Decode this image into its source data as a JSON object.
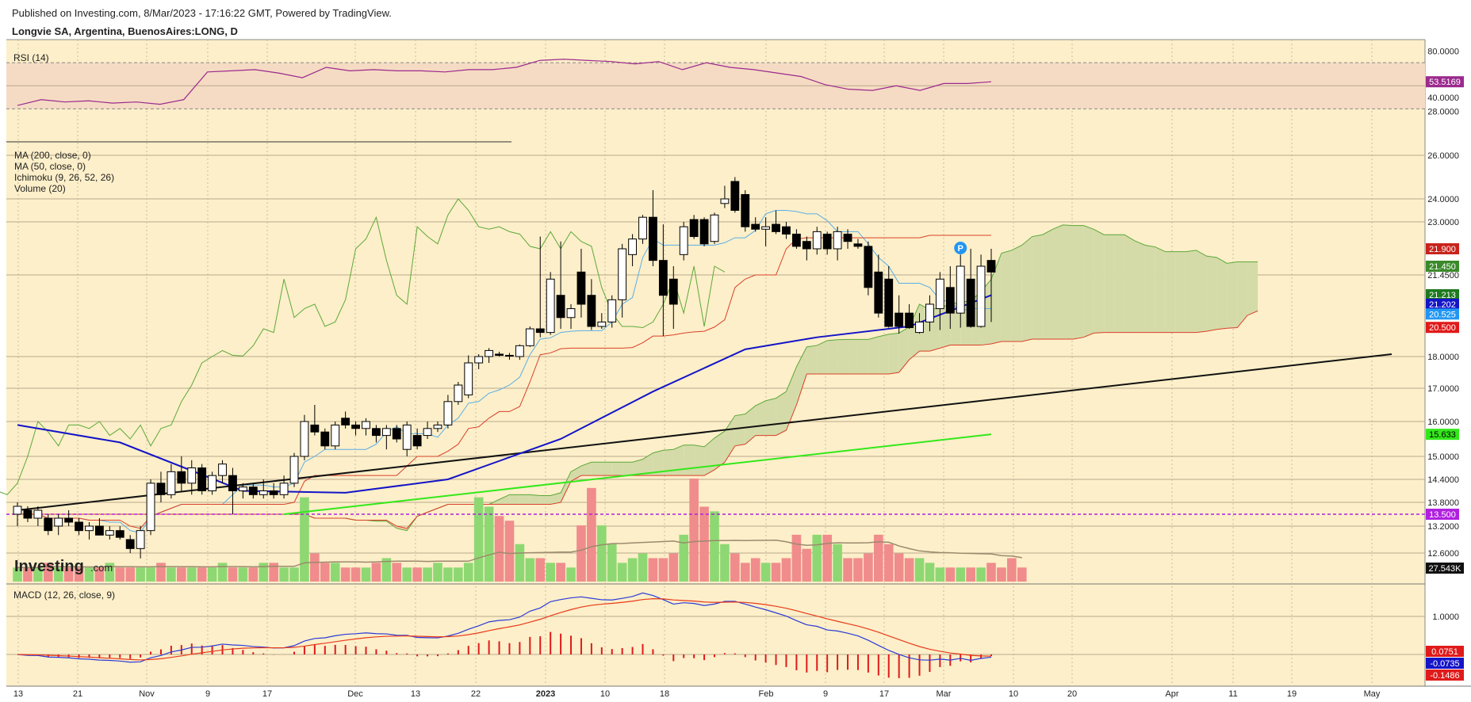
{
  "header": {
    "published": "Published on Investing.com, 8/Mar/2023 - 17:16:22 GMT, Powered by TradingView.",
    "symbol": "Longvie SA, Argentina, BuenosAires:LONG, D"
  },
  "branding": {
    "logo": "Investing",
    "logo_suffix": ".com"
  },
  "colors": {
    "background": "#fdefc9",
    "rsi_band": "#f5dbc3",
    "rsi_line": "#9b2a8e",
    "ma200": "#33e81a",
    "ma50": "#1414c8",
    "tenkan": "#5aaee8",
    "kijun": "#d9402a",
    "span_a": "#5da83a",
    "span_b": "#d9402a",
    "kumo_bull": "#d4dba8",
    "kumo_bear": "#f8c8a8",
    "trendline": "#111111",
    "support_line": "#b020e0",
    "vol_up": "#8ed873",
    "vol_down": "#f08c8c",
    "macd_line": "#2b3ad8",
    "signal_line": "#e83a1a",
    "hist": "#e01a1a"
  },
  "chart_data": [
    {
      "type": "line",
      "panel": "rsi",
      "label": "RSI (14)",
      "ylim": [
        20,
        90
      ],
      "levels": [
        28,
        40,
        80
      ],
      "band": [
        30,
        70
      ],
      "last_value": "53.5169",
      "x": [
        "Oct 13",
        "Oct 17",
        "Oct 21",
        "Oct 25",
        "Oct 28",
        "Nov 1",
        "Nov 4",
        "Nov 9",
        "Nov 11",
        "Nov 14",
        "Nov 17",
        "Nov 21",
        "Nov 24",
        "Nov 28",
        "Dec 1",
        "Dec 5",
        "Dec 9",
        "Dec 13",
        "Dec 16",
        "Dec 19",
        "Dec 22",
        "Dec 27",
        "Dec 30",
        "Jan 4",
        "Jan 7",
        "Jan 10",
        "Jan 14",
        "Jan 18",
        "Jan 20",
        "Jan 24",
        "Jan 28",
        "Feb 1",
        "Feb 4",
        "Feb 9",
        "Feb 13",
        "Feb 17",
        "Feb 21",
        "Feb 24",
        "Feb 28",
        "Mar 2",
        "Mar 6",
        "Mar 8"
      ],
      "values": [
        33,
        38,
        36,
        37,
        35,
        36,
        34,
        38,
        62,
        63,
        64,
        61,
        57,
        66,
        63,
        64,
        63,
        63,
        62,
        64,
        64,
        66,
        72,
        73,
        72,
        71,
        69,
        71,
        64,
        70,
        66,
        64,
        61,
        58,
        51,
        47,
        46,
        50,
        46,
        52,
        52,
        53.5
      ]
    },
    {
      "type": "candlestick",
      "panel": "price",
      "labels": [
        "MA (200, close, 0)",
        "MA (50, close, 0)",
        "Ichimoku (9, 26, 52, 26)",
        "Volume (20)"
      ],
      "ylim": [
        12.1,
        27.0
      ],
      "y_ticks": [
        12.6,
        13.2,
        13.8,
        14.4,
        15.0,
        16.0,
        17.0,
        18.0,
        21.45,
        23.0,
        24.0,
        26.0
      ],
      "price_tags": [
        {
          "value": "21.900",
          "bg": "#c8241c",
          "fg": "#ffffff",
          "y": 21.9
        },
        {
          "value": "21.450",
          "bg": "#3a8a2a",
          "fg": "#ffffff",
          "y": 21.6
        },
        {
          "value": "21.213",
          "bg": "#1f7a1f",
          "fg": "#ffffff",
          "y": 21.213
        },
        {
          "value": "21.202",
          "bg": "#1414c8",
          "fg": "#ffffff",
          "y": 21.0
        },
        {
          "value": "20.525",
          "bg": "#2196f3",
          "fg": "#ffffff",
          "y": 20.78
        },
        {
          "value": "20.500",
          "bg": "#e01a1a",
          "fg": "#ffffff",
          "y": 20.42
        },
        {
          "value": "15.633",
          "bg": "#33e81a",
          "fg": "#000000",
          "y": 15.633
        },
        {
          "value": "13.500",
          "bg": "#b020e0",
          "fg": "#ffffff",
          "y": 13.5
        }
      ],
      "candles": [
        {
          "d": "Oct 13",
          "o": 13.5,
          "h": 13.8,
          "l": 13.2,
          "c": 13.7
        },
        {
          "d": "Oct 17",
          "o": 13.6,
          "h": 13.7,
          "l": 13.3,
          "c": 13.4
        },
        {
          "d": "Oct 19",
          "o": 13.4,
          "h": 13.7,
          "l": 13.2,
          "c": 13.6
        },
        {
          "d": "Oct 21",
          "o": 13.4,
          "h": 13.5,
          "l": 13.0,
          "c": 13.1
        },
        {
          "d": "Oct 24",
          "o": 13.2,
          "h": 13.5,
          "l": 13.0,
          "c": 13.4
        },
        {
          "d": "Oct 26",
          "o": 13.4,
          "h": 13.6,
          "l": 13.2,
          "c": 13.3
        },
        {
          "d": "Oct 28",
          "o": 13.3,
          "h": 13.4,
          "l": 13.0,
          "c": 13.1
        },
        {
          "d": "Oct 31",
          "o": 13.1,
          "h": 13.3,
          "l": 12.9,
          "c": 13.2
        },
        {
          "d": "Nov 2",
          "o": 13.2,
          "h": 13.4,
          "l": 13.0,
          "c": 13.0
        },
        {
          "d": "Nov 4",
          "o": 13.0,
          "h": 13.2,
          "l": 12.9,
          "c": 13.1
        },
        {
          "d": "Nov 7",
          "o": 13.1,
          "h": 13.2,
          "l": 12.9,
          "c": 12.95
        },
        {
          "d": "Nov 9",
          "o": 12.9,
          "h": 13.0,
          "l": 12.6,
          "c": 12.7
        },
        {
          "d": "Nov 10",
          "o": 12.7,
          "h": 13.2,
          "l": 12.5,
          "c": 13.1
        },
        {
          "d": "Nov 11",
          "o": 13.1,
          "h": 14.4,
          "l": 13.0,
          "c": 14.3
        },
        {
          "d": "Nov 14",
          "o": 14.3,
          "h": 14.6,
          "l": 13.8,
          "c": 14.0
        },
        {
          "d": "Nov 15",
          "o": 14.0,
          "h": 14.8,
          "l": 13.9,
          "c": 14.6
        },
        {
          "d": "Nov 16",
          "o": 14.6,
          "h": 15.0,
          "l": 14.1,
          "c": 14.3
        },
        {
          "d": "Nov 17",
          "o": 14.3,
          "h": 14.9,
          "l": 14.0,
          "c": 14.7
        },
        {
          "d": "Nov 18",
          "o": 14.7,
          "h": 14.8,
          "l": 14.0,
          "c": 14.1
        },
        {
          "d": "Nov 21",
          "o": 14.1,
          "h": 14.6,
          "l": 14.0,
          "c": 14.5
        },
        {
          "d": "Nov 22",
          "o": 14.5,
          "h": 14.9,
          "l": 14.3,
          "c": 14.8
        },
        {
          "d": "Nov 23",
          "o": 14.5,
          "h": 14.7,
          "l": 13.5,
          "c": 14.1
        },
        {
          "d": "Nov 24",
          "o": 14.1,
          "h": 14.3,
          "l": 13.9,
          "c": 14.2
        },
        {
          "d": "Nov 25",
          "o": 14.2,
          "h": 14.3,
          "l": 13.9,
          "c": 14.0
        },
        {
          "d": "Nov 28",
          "o": 14.0,
          "h": 14.4,
          "l": 13.9,
          "c": 14.1
        },
        {
          "d": "Nov 29",
          "o": 14.1,
          "h": 14.3,
          "l": 13.9,
          "c": 14.0
        },
        {
          "d": "Nov 30",
          "o": 14.0,
          "h": 14.5,
          "l": 13.9,
          "c": 14.3
        },
        {
          "d": "Dec 1",
          "o": 14.3,
          "h": 15.1,
          "l": 14.2,
          "c": 15.0
        },
        {
          "d": "Dec 2",
          "o": 15.0,
          "h": 16.2,
          "l": 14.9,
          "c": 16.0
        },
        {
          "d": "Dec 5",
          "o": 15.9,
          "h": 16.5,
          "l": 15.6,
          "c": 15.7
        },
        {
          "d": "Dec 6",
          "o": 15.7,
          "h": 15.8,
          "l": 15.2,
          "c": 15.3
        },
        {
          "d": "Dec 7",
          "o": 15.3,
          "h": 16.0,
          "l": 15.2,
          "c": 15.9
        },
        {
          "d": "Dec 9",
          "o": 16.1,
          "h": 16.3,
          "l": 15.8,
          "c": 15.9
        },
        {
          "d": "Dec 12",
          "o": 15.9,
          "h": 16.0,
          "l": 15.6,
          "c": 15.8
        },
        {
          "d": "Dec 13",
          "o": 15.8,
          "h": 16.1,
          "l": 15.6,
          "c": 16.0
        },
        {
          "d": "Dec 14",
          "o": 15.8,
          "h": 15.9,
          "l": 15.4,
          "c": 15.6
        },
        {
          "d": "Dec 15",
          "o": 15.6,
          "h": 15.9,
          "l": 15.2,
          "c": 15.8
        },
        {
          "d": "Dec 16",
          "o": 15.8,
          "h": 15.9,
          "l": 15.4,
          "c": 15.5
        },
        {
          "d": "Dec 19",
          "o": 15.2,
          "h": 16.0,
          "l": 15.0,
          "c": 15.9
        },
        {
          "d": "Dec 20",
          "o": 15.6,
          "h": 15.8,
          "l": 15.2,
          "c": 15.3
        },
        {
          "d": "Dec 21",
          "o": 15.6,
          "h": 16.0,
          "l": 15.5,
          "c": 15.8
        },
        {
          "d": "Dec 22",
          "o": 15.8,
          "h": 16.0,
          "l": 15.7,
          "c": 15.9
        },
        {
          "d": "Dec 23",
          "o": 15.9,
          "h": 16.8,
          "l": 15.8,
          "c": 16.6
        },
        {
          "d": "Dec 26",
          "o": 16.6,
          "h": 17.2,
          "l": 16.5,
          "c": 17.1
        },
        {
          "d": "Dec 27",
          "o": 16.8,
          "h": 18.1,
          "l": 16.7,
          "c": 17.8
        },
        {
          "d": "Dec 28",
          "o": 17.8,
          "h": 18.2,
          "l": 17.6,
          "c": 18.0
        },
        {
          "d": "Dec 29",
          "o": 18.0,
          "h": 18.7,
          "l": 17.8,
          "c": 18.5
        },
        {
          "d": "Dec 30",
          "o": 18.2,
          "h": 18.4,
          "l": 18.0,
          "c": 18.1
        },
        {
          "d": "Jan 2",
          "o": 18.1,
          "h": 18.3,
          "l": 17.9,
          "c": 18.05
        },
        {
          "d": "Jan 3",
          "o": 18.0,
          "h": 19.0,
          "l": 17.9,
          "c": 18.9
        },
        {
          "d": "Jan 4",
          "o": 18.9,
          "h": 20.5,
          "l": 18.8,
          "c": 20.3
        },
        {
          "d": "Jan 5",
          "o": 20.3,
          "h": 22.4,
          "l": 19.6,
          "c": 20.0
        },
        {
          "d": "Jan 6",
          "o": 20.0,
          "h": 21.5,
          "l": 19.8,
          "c": 21.4
        },
        {
          "d": "Jan 9",
          "o": 21.2,
          "h": 22.2,
          "l": 20.3,
          "c": 20.7
        },
        {
          "d": "Jan 10",
          "o": 20.7,
          "h": 21.0,
          "l": 20.3,
          "c": 20.9
        },
        {
          "d": "Jan 11",
          "o": 21.5,
          "h": 21.9,
          "l": 20.7,
          "c": 21.0
        },
        {
          "d": "Jan 12",
          "o": 21.2,
          "h": 21.4,
          "l": 20.2,
          "c": 20.5
        },
        {
          "d": "Jan 13",
          "o": 20.5,
          "h": 20.8,
          "l": 20.3,
          "c": 20.6
        },
        {
          "d": "Jan 16",
          "o": 20.6,
          "h": 21.2,
          "l": 20.4,
          "c": 21.1
        },
        {
          "d": "Jan 17",
          "o": 21.1,
          "h": 22.1,
          "l": 20.7,
          "c": 21.9
        },
        {
          "d": "Jan 18",
          "o": 21.8,
          "h": 22.5,
          "l": 21.6,
          "c": 22.3
        },
        {
          "d": "Jan 19",
          "o": 22.3,
          "h": 23.3,
          "l": 22.1,
          "c": 23.2
        },
        {
          "d": "Jan 20",
          "o": 23.2,
          "h": 24.4,
          "l": 21.6,
          "c": 21.7
        },
        {
          "d": "Jan 23",
          "o": 21.7,
          "h": 22.9,
          "l": 19.7,
          "c": 21.2
        },
        {
          "d": "Jan 24",
          "o": 21.4,
          "h": 21.6,
          "l": 20.3,
          "c": 21.0
        },
        {
          "d": "Jan 25",
          "o": 21.8,
          "h": 23.0,
          "l": 21.7,
          "c": 22.8
        },
        {
          "d": "Jan 26",
          "o": 23.1,
          "h": 23.3,
          "l": 22.3,
          "c": 22.4
        },
        {
          "d": "Jan 27",
          "o": 23.1,
          "h": 23.2,
          "l": 22.0,
          "c": 22.1
        },
        {
          "d": "Jan 30",
          "o": 22.2,
          "h": 23.4,
          "l": 22.1,
          "c": 23.3
        },
        {
          "d": "Jan 31",
          "o": 23.8,
          "h": 24.6,
          "l": 23.6,
          "c": 24.0
        },
        {
          "d": "Feb 1",
          "o": 24.8,
          "h": 25.0,
          "l": 23.4,
          "c": 23.5
        },
        {
          "d": "Feb 2",
          "o": 24.2,
          "h": 24.4,
          "l": 22.6,
          "c": 22.8
        },
        {
          "d": "Feb 3",
          "o": 22.9,
          "h": 23.2,
          "l": 22.6,
          "c": 22.7
        },
        {
          "d": "Feb 6",
          "o": 22.7,
          "h": 23.2,
          "l": 22.0,
          "c": 22.8
        },
        {
          "d": "Feb 7",
          "o": 22.9,
          "h": 23.5,
          "l": 22.5,
          "c": 22.6
        },
        {
          "d": "Feb 8",
          "o": 22.8,
          "h": 23.0,
          "l": 22.3,
          "c": 22.5
        },
        {
          "d": "Feb 9",
          "o": 22.5,
          "h": 22.7,
          "l": 21.9,
          "c": 22.0
        },
        {
          "d": "Feb 10",
          "o": 22.2,
          "h": 22.4,
          "l": 21.7,
          "c": 21.9
        },
        {
          "d": "Feb 13",
          "o": 21.9,
          "h": 22.8,
          "l": 21.8,
          "c": 22.6
        },
        {
          "d": "Feb 14",
          "o": 22.5,
          "h": 22.6,
          "l": 21.8,
          "c": 21.9
        },
        {
          "d": "Feb 15",
          "o": 21.9,
          "h": 22.8,
          "l": 21.7,
          "c": 22.6
        },
        {
          "d": "Feb 16",
          "o": 22.5,
          "h": 22.7,
          "l": 21.9,
          "c": 22.2
        },
        {
          "d": "Feb 17",
          "o": 22.1,
          "h": 22.3,
          "l": 21.9,
          "c": 22.0
        },
        {
          "d": "Feb 20",
          "o": 22.0,
          "h": 22.2,
          "l": 21.2,
          "c": 21.3
        },
        {
          "d": "Feb 21",
          "o": 21.5,
          "h": 21.8,
          "l": 20.7,
          "c": 20.8
        },
        {
          "d": "Feb 22",
          "o": 21.4,
          "h": 21.6,
          "l": 20.4,
          "c": 20.5
        },
        {
          "d": "Feb 23",
          "o": 20.8,
          "h": 21.2,
          "l": 19.9,
          "c": 20.5
        },
        {
          "d": "Feb 24",
          "o": 20.8,
          "h": 21.0,
          "l": 20.3,
          "c": 20.4
        },
        {
          "d": "Feb 27",
          "o": 20.0,
          "h": 20.8,
          "l": 19.9,
          "c": 20.6
        },
        {
          "d": "Feb 28",
          "o": 20.6,
          "h": 21.2,
          "l": 20.1,
          "c": 21.0
        },
        {
          "d": "Mar 1",
          "o": 20.9,
          "h": 21.5,
          "l": 20.2,
          "c": 21.4
        },
        {
          "d": "Mar 2",
          "o": 21.3,
          "h": 21.6,
          "l": 20.3,
          "c": 20.8
        },
        {
          "d": "Mar 3",
          "o": 20.8,
          "h": 21.8,
          "l": 20.4,
          "c": 21.6
        },
        {
          "d": "Mar 6",
          "o": 21.4,
          "h": 21.9,
          "l": 20.4,
          "c": 20.5
        },
        {
          "d": "Mar 7",
          "o": 20.5,
          "h": 21.8,
          "l": 20.4,
          "c": 21.6
        },
        {
          "d": "Mar 8",
          "o": 21.7,
          "h": 21.9,
          "l": 20.6,
          "c": 21.5
        }
      ],
      "ma200": {
        "x": [
          "Nov 30",
          "Mar 8"
        ],
        "values": [
          13.5,
          15.633
        ]
      },
      "ma50": {
        "x": [
          "Oct 13",
          "Nov 7",
          "Nov 24",
          "Dec 9",
          "Dec 23",
          "Jan 9",
          "Jan 20",
          "Feb 2",
          "Feb 13",
          "Feb 24",
          "Mar 8"
        ],
        "values": [
          15.9,
          15.4,
          14.1,
          14.05,
          14.4,
          15.5,
          16.9,
          18.6,
          19.6,
          20.5,
          21.202
        ]
      },
      "trendline": {
        "x": [
          "Oct 13",
          "May 20"
        ],
        "values": [
          13.6,
          18.2
        ]
      },
      "support_line": {
        "value": 13.5
      },
      "events": [
        {
          "date": "Mar 3",
          "label": "P",
          "color": "#2196f3"
        }
      ]
    },
    {
      "type": "bar",
      "panel": "volume",
      "last_value": "27.543K",
      "values": [
        3,
        3,
        3,
        4,
        3,
        3,
        3,
        3,
        3,
        4,
        3,
        3,
        3,
        3,
        4,
        3,
        3,
        3,
        3,
        3,
        4,
        3,
        3,
        3,
        4,
        4,
        3,
        3,
        18,
        6,
        4,
        4,
        3,
        3,
        3,
        4,
        5,
        4,
        3,
        3,
        3,
        4,
        3,
        3,
        4,
        18,
        16,
        14,
        13,
        8,
        5,
        5,
        4,
        4,
        3,
        12,
        20,
        12,
        8,
        4,
        5,
        6,
        5,
        5,
        6,
        10,
        22,
        16,
        15,
        8,
        6,
        4,
        5,
        4,
        4,
        5,
        10,
        7,
        10,
        10,
        8,
        5,
        5,
        6,
        10,
        8,
        6,
        5,
        5,
        4,
        3,
        3,
        3,
        3,
        3,
        4,
        3,
        5,
        3
      ],
      "average_label": "Volume (20)"
    },
    {
      "type": "line",
      "panel": "macd",
      "label": "MACD (12, 26, close, 9)",
      "y_ticks": [
        1.0
      ],
      "values_tags": [
        {
          "value": "0.0751",
          "bg": "#e01a1a",
          "fg": "#ffffff"
        },
        {
          "value": "-0.0735",
          "bg": "#1414c8",
          "fg": "#ffffff"
        },
        {
          "value": "-0.1486",
          "bg": "#e01a1a",
          "fg": "#ffffff"
        }
      ]
    }
  ],
  "x_axis": {
    "labels": [
      "13",
      "21",
      "Nov",
      "9",
      "17",
      "Dec",
      "13",
      "22",
      "2023",
      "10",
      "18",
      "Feb",
      "9",
      "17",
      "Mar",
      "10",
      "20",
      "Apr",
      "11",
      "19",
      "May"
    ],
    "bold": [
      "2023"
    ]
  }
}
